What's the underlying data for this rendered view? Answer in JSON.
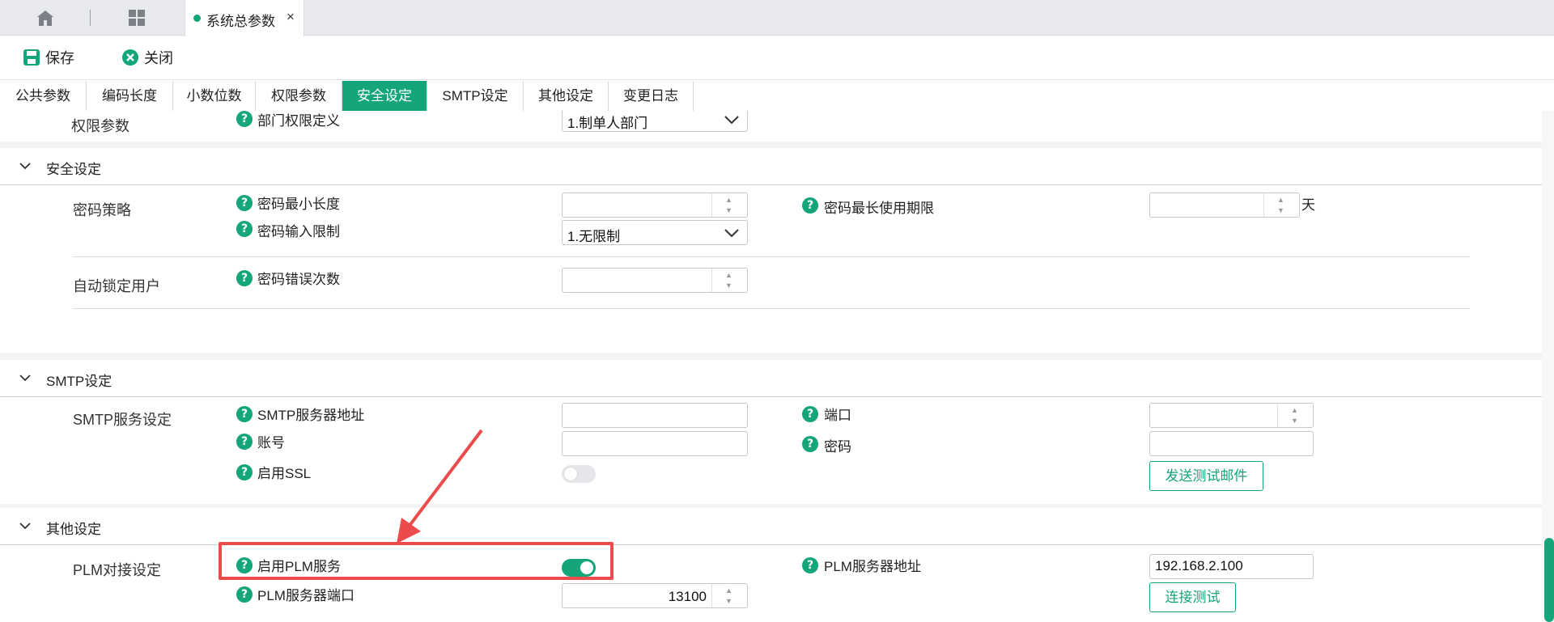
{
  "tabs": {
    "home_icon": "home-icon",
    "grid_icon": "grid-icon",
    "doc_tab": {
      "label": "系统总参数",
      "close": "×"
    }
  },
  "toolbar": {
    "save_label": "保存",
    "close_label": "关闭"
  },
  "subtabs": [
    "公共参数",
    "编码长度",
    "小数位数",
    "权限参数",
    "安全设定",
    "SMTP设定",
    "其他设定",
    "变更日志"
  ],
  "active_subtab": "安全设定",
  "permissions": {
    "group": "权限参数",
    "dept_label": "部门权限定义",
    "dept_value": "1.制单人部门"
  },
  "security": {
    "title": "安全设定",
    "password_policy": {
      "group": "密码策略",
      "min_length_label": "密码最小长度",
      "min_length_value": "",
      "max_days_label": "密码最长使用期限",
      "max_days_value": "",
      "max_days_unit": "天",
      "input_limit_label": "密码输入限制",
      "input_limit_value": "1.无限制"
    },
    "auto_lock": {
      "group": "自动锁定用户",
      "error_count_label": "密码错误次数",
      "error_count_value": ""
    }
  },
  "smtp": {
    "title": "SMTP设定",
    "group": "SMTP服务设定",
    "server_label": "SMTP服务器地址",
    "server_value": "",
    "port_label": "端口",
    "port_value": "",
    "account_label": "账号",
    "account_value": "",
    "password_label": "密码",
    "password_value": "",
    "ssl_label": "启用SSL",
    "ssl_enabled": false,
    "test_mail_button": "发送测试邮件"
  },
  "other": {
    "title": "其他设定",
    "group": "PLM对接设定",
    "enable_plm_label": "启用PLM服务",
    "enable_plm": true,
    "plm_server_label": "PLM服务器地址",
    "plm_server_value": "192.168.2.100",
    "plm_port_label": "PLM服务器端口",
    "plm_port_value": "13100",
    "connect_test_button": "连接测试"
  },
  "colors": {
    "accent": "#14a57a",
    "highlight": "#ec4b4b"
  }
}
